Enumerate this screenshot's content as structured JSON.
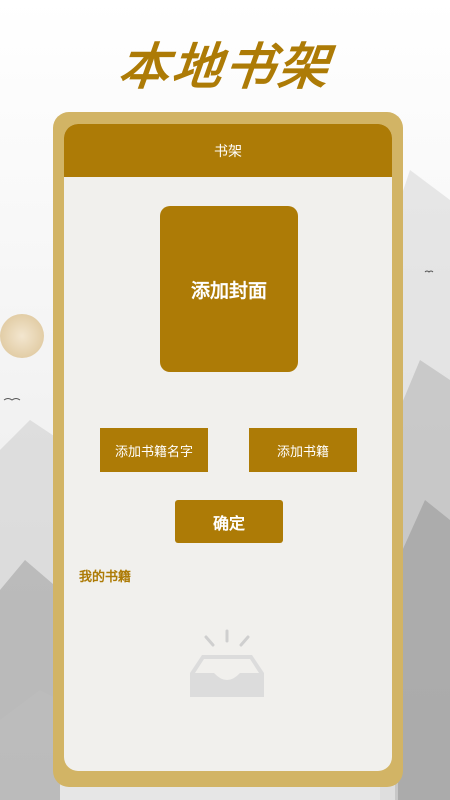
{
  "headline": "本地书架",
  "app": {
    "title": "书架",
    "add_cover_label": "添加封面",
    "add_name_label": "添加书籍名字",
    "add_book_label": "添加书籍",
    "confirm_label": "确定",
    "my_books_label": "我的书籍"
  },
  "colors": {
    "accent": "#ad7b06",
    "frame": "#d2b465",
    "screen_bg": "#f1f0ed"
  },
  "icons": {
    "empty_state": "empty-tray-icon"
  }
}
